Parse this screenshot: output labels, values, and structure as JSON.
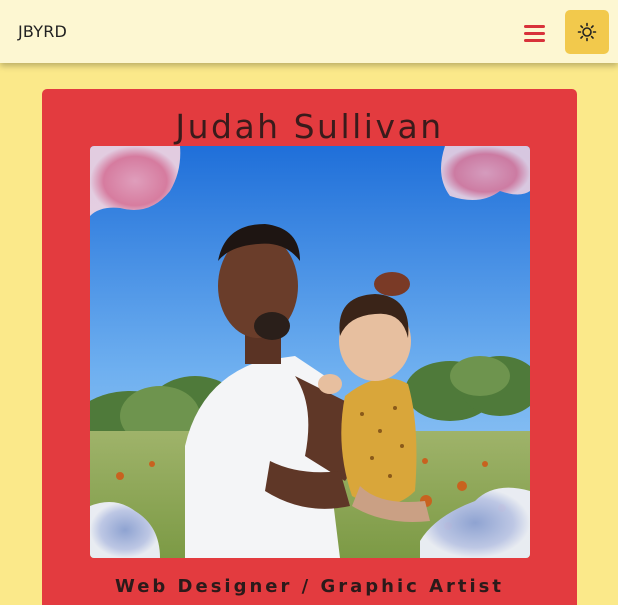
{
  "navbar": {
    "brand": "JBYRD",
    "menu_icon": "hamburger-menu-icon",
    "theme_icon": "sun-icon"
  },
  "hero": {
    "name": "Judah Sullivan",
    "subtitle": "Web Designer / Graphic Artist",
    "photo_description_icon": "profile-photo"
  },
  "colors": {
    "page_background": "#fbe98a",
    "navbar_background": "#fdf7d2",
    "card_background": "#e33b3f",
    "menu_icon": "#d8323a",
    "theme_button": "#f2c94c"
  }
}
